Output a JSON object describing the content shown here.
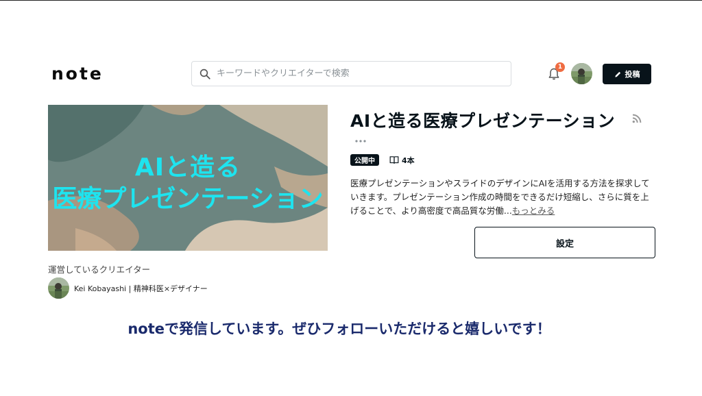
{
  "header": {
    "logo": "note",
    "search_placeholder": "キーワードやクリエイターで検索",
    "notification_count": "1",
    "post_label": "投稿"
  },
  "hero": {
    "line1": "AIと造る",
    "line2": "医療プレゼンテーション"
  },
  "magazine": {
    "title": "AIと造る医療プレゼンテーション",
    "status": "公開中",
    "count": "4本",
    "description": "医療プレゼンテーションやスライドのデザインにAIを活用する方法を探求していきます。プレゼンテーション作成の時間をできるだけ短縮し、さらに質を上げることで、より高密度で高品質な労働...",
    "more_link": "もっとみる",
    "settings_label": "設定"
  },
  "creator": {
    "heading": "運営しているクリエイター",
    "name": "Kei Kobayashi | 精神科医×デザイナー"
  },
  "footer": {
    "message": "noteで発信しています。ぜひフォローいただけると嬉しいです！"
  },
  "colors": {
    "accent_dark": "#08131a",
    "hero_text": "#1ee4ef",
    "badge": "#ef6c42",
    "footer_text": "#1a2a6c"
  }
}
